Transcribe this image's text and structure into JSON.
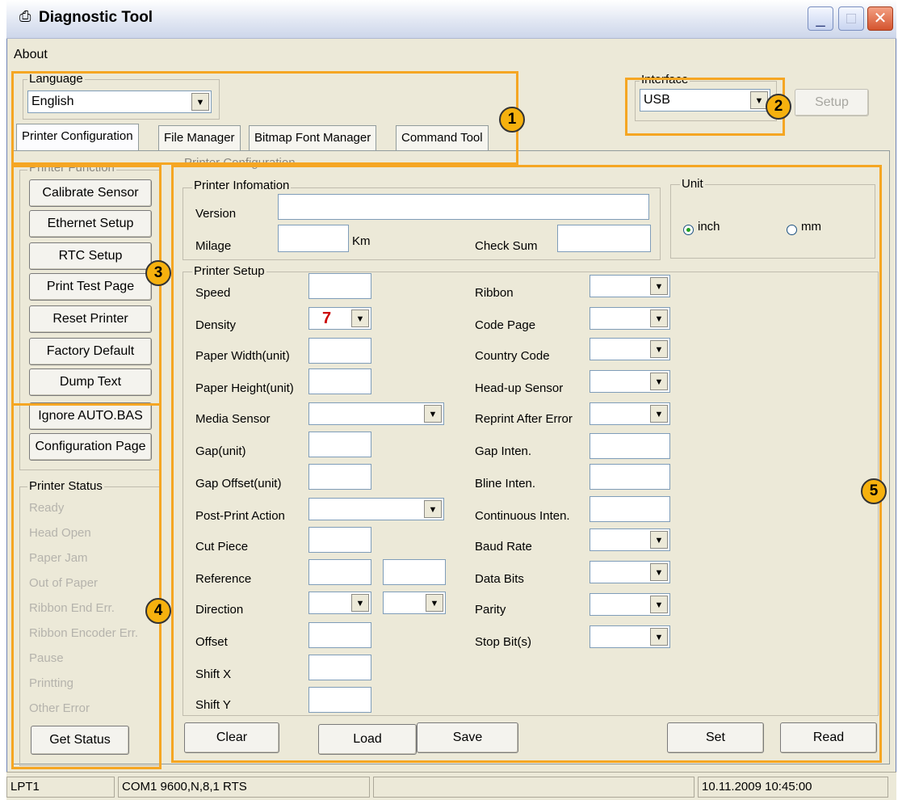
{
  "window": {
    "title": "Diagnostic Tool"
  },
  "menu": {
    "about": "About"
  },
  "language": {
    "label": "Language",
    "value": "English"
  },
  "interface": {
    "label": "Interface",
    "value": "USB",
    "setup_label": "Setup"
  },
  "tabs": [
    {
      "label": "Printer Configuration"
    },
    {
      "label": "File Manager"
    },
    {
      "label": "Bitmap Font Manager"
    },
    {
      "label": "Command Tool"
    }
  ],
  "printer_function": {
    "label": "Printer Function",
    "buttons": [
      "Calibrate Sensor",
      "Ethernet Setup",
      "RTC Setup",
      "Print Test Page",
      "Reset Printer",
      "Factory Default",
      "Dump Text",
      "Ignore AUTO.BAS",
      "Configuration Page"
    ]
  },
  "printer_status": {
    "label": "Printer Status",
    "items": [
      "Ready",
      "Head Open",
      "Paper Jam",
      "Out of Paper",
      "Ribbon End Err.",
      "Ribbon Encoder Err.",
      "Pause",
      "Printting",
      "Other Error"
    ],
    "get_status_label": "Get Status"
  },
  "config": {
    "label": "Printer Configuration",
    "info": {
      "label": "Printer Infomation",
      "version_label": "Version",
      "milage_label": "Milage",
      "km_label": "Km",
      "checksum_label": "Check Sum"
    },
    "unit": {
      "label": "Unit",
      "inch": "inch",
      "mm": "mm",
      "selected": "inch"
    },
    "setup": {
      "label": "Printer Setup",
      "speed": "Speed",
      "density": "Density",
      "density_value": "7",
      "paper_width": "Paper Width(unit)",
      "paper_height": "Paper Height(unit)",
      "media_sensor": "Media Sensor",
      "gap": "Gap(unit)",
      "gap_offset": "Gap Offset(unit)",
      "post_print": "Post-Print Action",
      "cut_piece": "Cut Piece",
      "reference": "Reference",
      "direction": "Direction",
      "offset": "Offset",
      "shift_x": "Shift X",
      "shift_y": "Shift Y",
      "ribbon": "Ribbon",
      "code_page": "Code Page",
      "country_code": "Country Code",
      "head_up_sensor": "Head-up Sensor",
      "reprint_after_error": "Reprint After Error",
      "gap_inten": "Gap Inten.",
      "bline_inten": "Bline Inten.",
      "continuous_inten": "Continuous Inten.",
      "baud_rate": "Baud Rate",
      "data_bits": "Data Bits",
      "parity": "Parity",
      "stop_bits": "Stop Bit(s)"
    },
    "actions": {
      "clear": "Clear",
      "load": "Load",
      "save": "Save",
      "set": "Set",
      "read": "Read"
    }
  },
  "badges": [
    "1",
    "2",
    "3",
    "4",
    "5"
  ],
  "statusbar": {
    "port": "LPT1",
    "com": "COM1 9600,N,8,1 RTS",
    "middle": "",
    "datetime": "10.11.2009 10:45:00"
  },
  "colors": {
    "highlight": "#f5a623",
    "badge": "#f6b10e",
    "density_value": "#cc0000"
  }
}
